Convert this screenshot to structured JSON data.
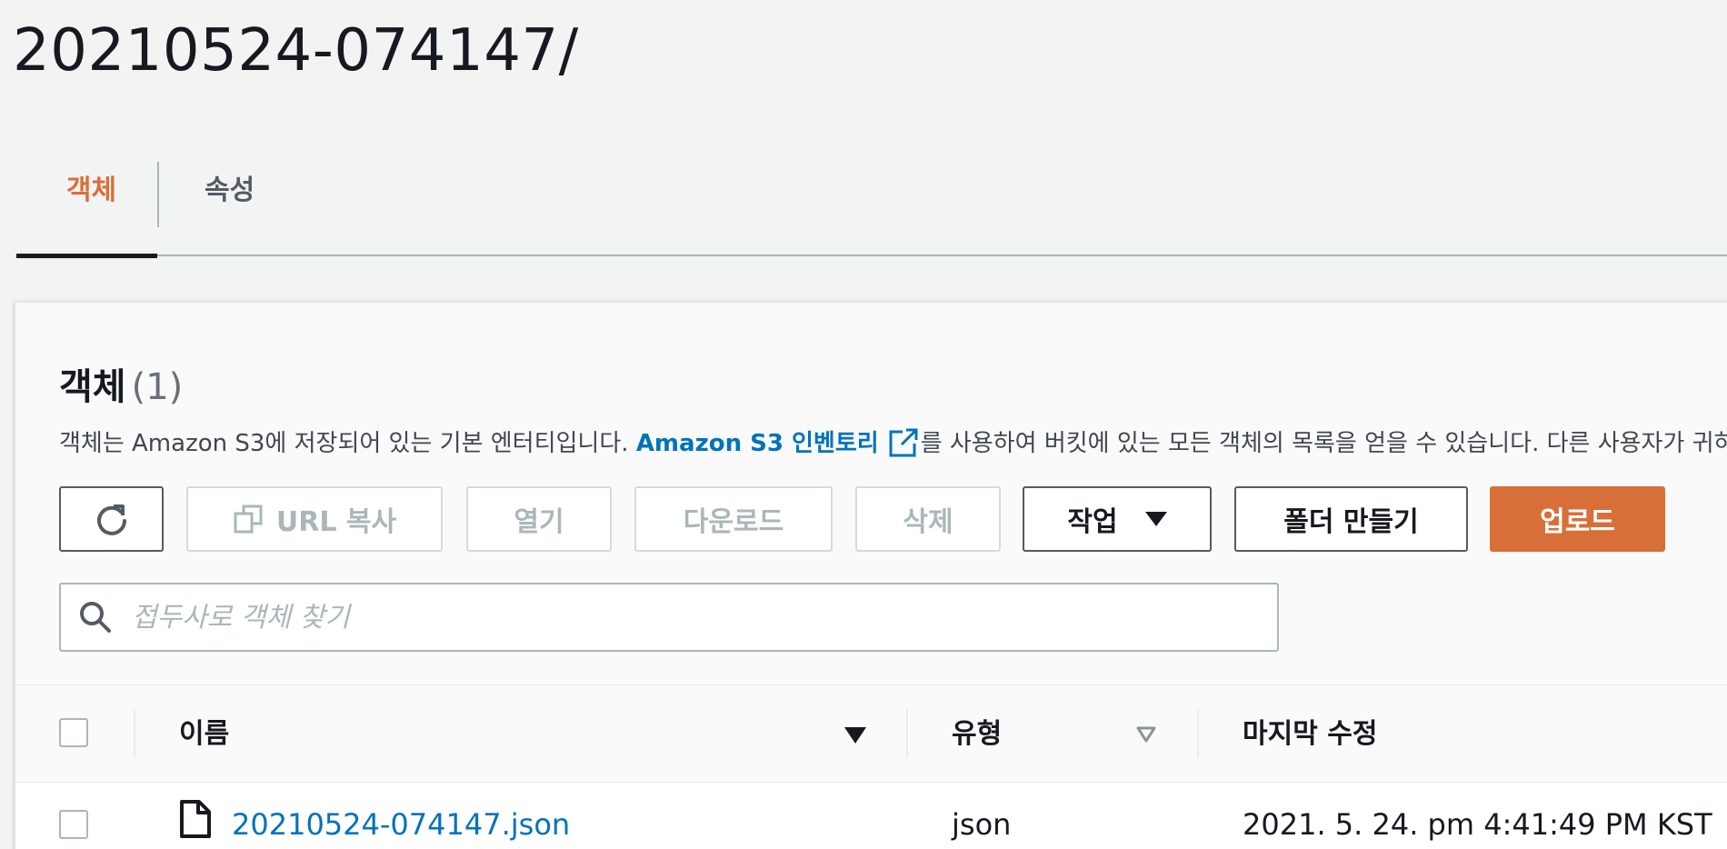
{
  "page": {
    "title": "20210524-074147/"
  },
  "tabs": [
    {
      "label": "객체",
      "active": true
    },
    {
      "label": "속성",
      "active": false
    }
  ],
  "panel": {
    "title": "객체",
    "count": "(1)",
    "description_before": "객체는 Amazon S3에 저장되어 있는 기본 엔터티입니다. ",
    "description_link": "Amazon S3 인벤토리",
    "description_after": "를 사용하여 버킷에 있는 모든 객체의 목록을 얻을 수 있습니다. 다른 사용자가 귀하의 객체에 액세스하려면 명시적으로 권한을 부여해야 합니다."
  },
  "toolbar": {
    "refresh_icon": "refresh-icon",
    "copy_url": "URL 복사",
    "open": "열기",
    "download": "다운로드",
    "delete": "삭제",
    "actions": "작업",
    "create_folder": "폴더 만들기",
    "upload": "업로드"
  },
  "search": {
    "placeholder": "접두사로 객체 찾기",
    "value": ""
  },
  "table": {
    "columns": [
      "이름",
      "유형",
      "마지막 수정"
    ],
    "rows": [
      {
        "name": "20210524-074147.json",
        "type": "json",
        "modified": "2021. 5. 24. pm 4:41:49 PM KST"
      }
    ]
  },
  "colors": {
    "accent": "#d86f39",
    "link": "#0073bb",
    "text": "#16191f",
    "muted": "#545b64",
    "disabled": "#aab7b8",
    "background": "#f2f3f3"
  }
}
